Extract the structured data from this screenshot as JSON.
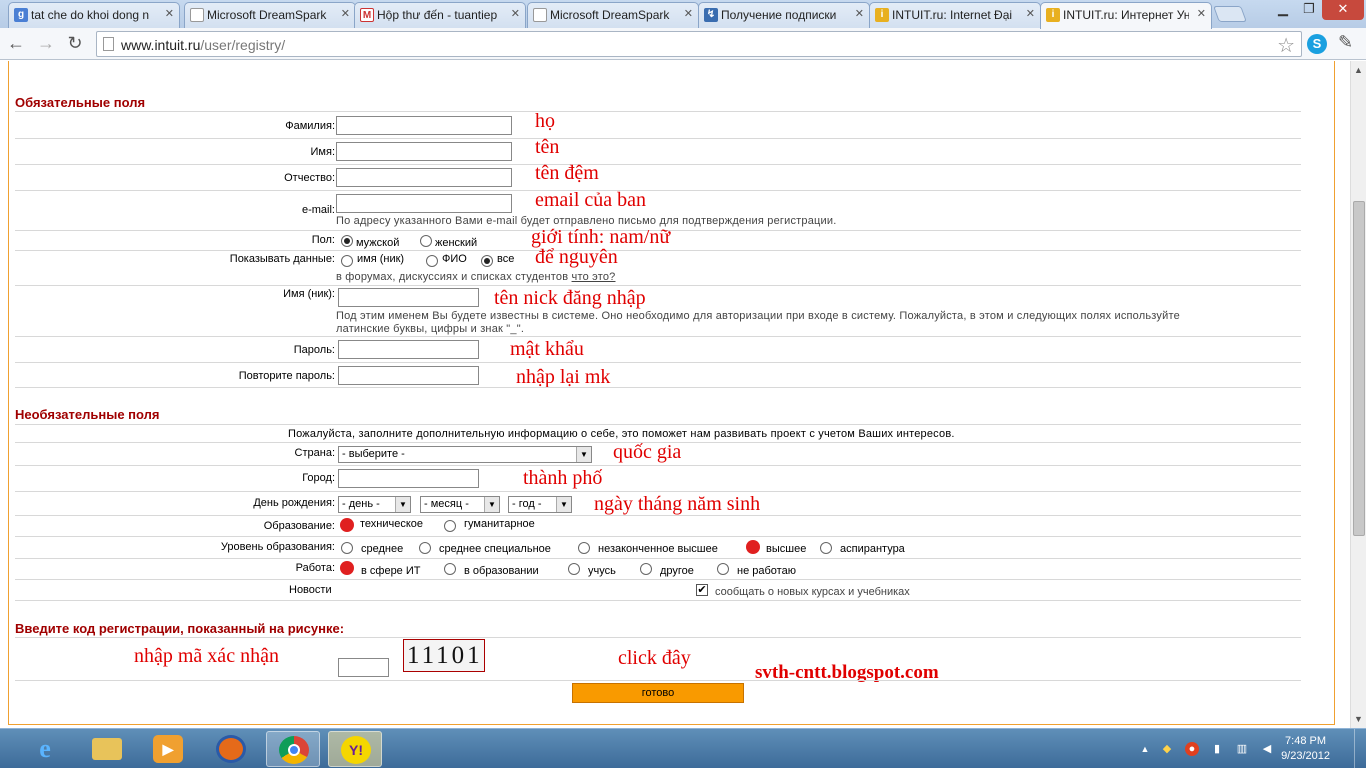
{
  "browser": {
    "tabs": [
      {
        "label": "tat che do khoi dong n",
        "icon": "google-icon",
        "active": false
      },
      {
        "label": "Microsoft DreamSpark",
        "icon": "page-icon",
        "active": false
      },
      {
        "label": "Hộp thư đến - tuantiep",
        "icon": "gmail-icon",
        "active": false
      },
      {
        "label": "Microsoft DreamSpark",
        "icon": "page-icon",
        "active": false
      },
      {
        "label": "Получение подписки",
        "icon": "site-icon",
        "active": false
      },
      {
        "label": "INTUIT.ru: Internet Đại",
        "icon": "intuit-icon",
        "active": false
      },
      {
        "label": "INTUIT.ru: Интернет Ун",
        "icon": "intuit-icon",
        "active": true
      }
    ],
    "url_host": "www.intuit.ru",
    "url_path": "/user/registry/"
  },
  "form": {
    "required_title": "Обязательные поля",
    "surname_label": "Фамилия:",
    "name_label": "Имя:",
    "patronymic_label": "Отчество:",
    "email_label": "e-mail:",
    "email_note": "По адресу указанного Вами e-mail будет отправлено письмо для подтверждения регистрации.",
    "gender_label": "Пол:",
    "gender_male": "мужской",
    "gender_female": "женский",
    "show_data_label": "Показывать данные:",
    "show_nick": "имя (ник)",
    "show_fio": "ФИО",
    "show_all": "все",
    "show_note": "в форумах, дискуссиях и списках студентов",
    "show_link": "что это?",
    "nick_label": "Имя (ник):",
    "nick_note_1": "Под этим именем Вы будете известны в системе. Оно необходимо для авторизации при входе в систему. Пожалуйста, в этом и следующих полях используйте",
    "nick_note_2": "латинские буквы, цифры и знак \"_\".",
    "password_label": "Пароль:",
    "password_repeat_label": "Повторите пароль:",
    "optional_title": "Необязательные поля",
    "optional_note": "Пожалуйста, заполните дополнительную информацию о себе, это поможет нам развивать проект с учетом Ваших интересов.",
    "country_label": "Страна:",
    "country_value": "- выберите -",
    "city_label": "Город:",
    "birthday_label": "День рождения:",
    "day_value": "- день -",
    "month_value": "- месяц -",
    "year_value": "- год -",
    "education_label": "Образование:",
    "edu_tech": "техническое",
    "edu_human": "гуманитарное",
    "level_label": "Уровень образования:",
    "level_options": [
      "среднее",
      "среднее специальное",
      "незаконченное высшее",
      "высшее",
      "аспирантура"
    ],
    "work_label": "Работа:",
    "work_options": [
      "в сфере ИТ",
      "в образовании",
      "учусь",
      "другое",
      "не работаю"
    ],
    "news_label": "Новости",
    "news_checkbox": "сообщать о новых курсах и учебниках",
    "captcha_title": "Введите код регистрации, показанный на рисунке:",
    "captcha_text": "11101",
    "submit_label": "готово"
  },
  "annotations": {
    "surname": "họ",
    "name": "tên",
    "patronymic": "tên đệm",
    "email": "email của ban",
    "gender": "giới tính: nam/nữ",
    "show_data": "để nguyên",
    "nick": "tên nick đăng nhập",
    "password": "mật khẩu",
    "password_repeat": "nhập lại mk",
    "country": "quốc gia",
    "city": "thành phố",
    "birthday": "ngày tháng năm sinh",
    "captcha": "nhập mã xác nhận",
    "click": "click đây",
    "watermark": "svth-cntt.blogspot.com"
  },
  "taskbar": {
    "apps": [
      "ie-icon",
      "explorer-icon",
      "media-player-icon",
      "firefox-icon",
      "chrome-icon",
      "yahoo-messenger-icon"
    ],
    "time": "7:48 PM",
    "date": "9/23/2012"
  },
  "colors": {
    "section_title": "#a00000",
    "annotation": "#e00000",
    "submit_button": "#f99a00",
    "frame_border": "#f0a030"
  }
}
